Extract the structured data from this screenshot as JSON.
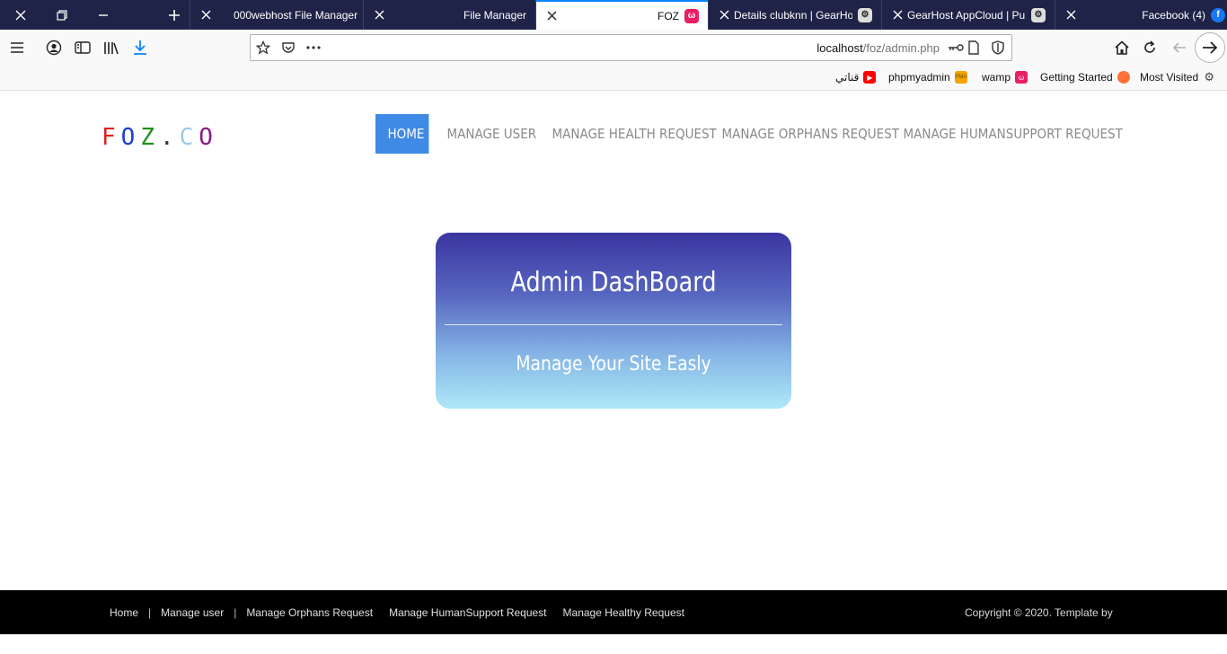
{
  "tabs": [
    {
      "label": "000webhost File Manager"
    },
    {
      "label": "File Manager"
    },
    {
      "label": "FOZ",
      "icon": "pink-app-icon"
    },
    {
      "label": "Details clubknn | GearHo",
      "icon": "gear-icon"
    },
    {
      "label": "GearHost AppCloud | Pul",
      "icon": "gear-icon"
    },
    {
      "label": "Facebook (4)",
      "icon": "facebook-icon"
    }
  ],
  "url": {
    "host": "localhost",
    "path": "/foz/admin.php"
  },
  "bookmarks": [
    {
      "label": "قناتي",
      "icon": "youtube-icon"
    },
    {
      "label": "phpmyadmin",
      "icon": "phpmyadmin-icon"
    },
    {
      "label": "wamp",
      "icon": "pink-app-icon"
    },
    {
      "label": "Getting Started",
      "icon": "firefox-icon"
    },
    {
      "label": "Most Visited",
      "icon": "gear-icon"
    }
  ],
  "logo": {
    "letters": [
      "F",
      "O",
      "Z",
      ".",
      "C",
      "O"
    ],
    "colors": [
      "#e02020",
      "#1a3fd1",
      "#1a8f1a",
      "#333333",
      "#9ec9e6",
      "#8a1a8a"
    ]
  },
  "nav": [
    {
      "label": "HOME",
      "active": true
    },
    {
      "label": "MANAGE USER"
    },
    {
      "label": "MANAGE HEALTH REQUEST"
    },
    {
      "label": "MANAGE ORPHANS REQUEST"
    },
    {
      "label": "MANAGE HUMANSUPPORT REQUEST"
    }
  ],
  "hero": {
    "title": "Admin DashBoard",
    "subtitle": "Manage Your Site Easly"
  },
  "footer": {
    "links": [
      "Home",
      "Manage user",
      "Manage Orphans Request",
      "Manage HumanSupport Request",
      "Manage Healthy Request"
    ],
    "separator": "|",
    "copyright": "Copyright © 2020. Template by"
  },
  "colors": {
    "tabstrip": "#1f2347",
    "accent": "#0a84ff",
    "nav_active": "#3e8ae5"
  }
}
